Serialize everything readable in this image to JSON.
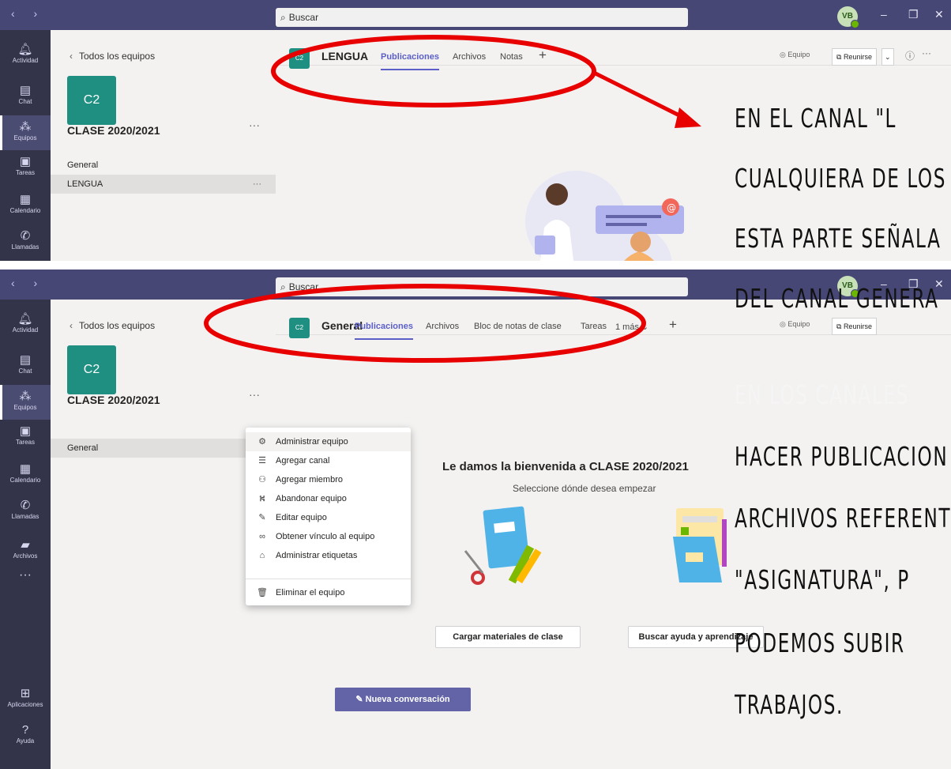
{
  "search": {
    "placeholder": "Buscar"
  },
  "user": {
    "initials": "VB"
  },
  "window": {
    "minimize": "–",
    "restore": "❐",
    "close": "✕"
  },
  "rail": {
    "top": [
      "Actividad",
      "Chat",
      "Equipos",
      "Tareas",
      "Calendario",
      "Llamadas"
    ],
    "bottom": [
      "Actividad",
      "Chat",
      "Equipos",
      "Tareas",
      "Calendario",
      "Llamadas",
      "Archivos"
    ],
    "more": "···",
    "apps": "Aplicaciones",
    "help": "Ayuda"
  },
  "team": {
    "back_label": "Todos los equipos",
    "tile_label": "C2",
    "name": "CLASE 2020/2021",
    "more": "···"
  },
  "top_screen": {
    "channels": [
      {
        "label": "General"
      },
      {
        "label": "LENGUA",
        "more": "···"
      }
    ],
    "channel_tile": "C2",
    "channel_title": "LENGUA",
    "tabs": [
      "Publicaciones",
      "Archivos",
      "Notas"
    ],
    "add_tab": "+",
    "equipo_label": "Equipo",
    "reunirse_label": "Reunirse",
    "info": "ⓘ",
    "more": "···"
  },
  "bottom_screen": {
    "channels": [
      {
        "label": "General"
      }
    ],
    "channel_tile": "C2",
    "channel_title": "General",
    "tabs": [
      "Publicaciones",
      "Archivos",
      "Bloc de notas de clase",
      "Tareas",
      "1 más"
    ],
    "add_tab": "+",
    "equipo_label": "Equipo",
    "reunirse_label": "Reunirse",
    "welcome_title": "Le damos la bienvenida a CLASE 2020/2021",
    "welcome_sub": "Seleccione dónde desea empezar",
    "card1_button": "Cargar materiales de clase",
    "card2_button": "Buscar ayuda y aprendizaje",
    "new_conversation": "Nueva conversación",
    "menu": [
      {
        "icon": "gear-icon",
        "label": "Administrar equipo"
      },
      {
        "icon": "channel-icon",
        "label": "Agregar canal"
      },
      {
        "icon": "add-member-icon",
        "label": "Agregar miembro"
      },
      {
        "icon": "leave-icon",
        "label": "Abandonar equipo"
      },
      {
        "icon": "edit-icon",
        "label": "Editar equipo"
      },
      {
        "icon": "link-icon",
        "label": "Obtener vínculo al equipo"
      },
      {
        "icon": "tag-icon",
        "label": "Administrar etiquetas"
      },
      {
        "icon": "trash-icon",
        "label": "Eliminar el equipo"
      }
    ]
  },
  "annotation": {
    "lines": [
      "EN EL CANAL \"L",
      "CUALQUIERA DE LOS",
      "ESTA PARTE SEÑALA",
      "DEL CANAL GENERA",
      "EN LOS CANALES",
      "HACER PUBLICACION",
      "ARCHIVOS REFERENT",
      "\"ASIGNATURA\",    P",
      "PODEMOS SUBIR",
      "TRABAJOS."
    ],
    "ink_color": "#e80000"
  }
}
